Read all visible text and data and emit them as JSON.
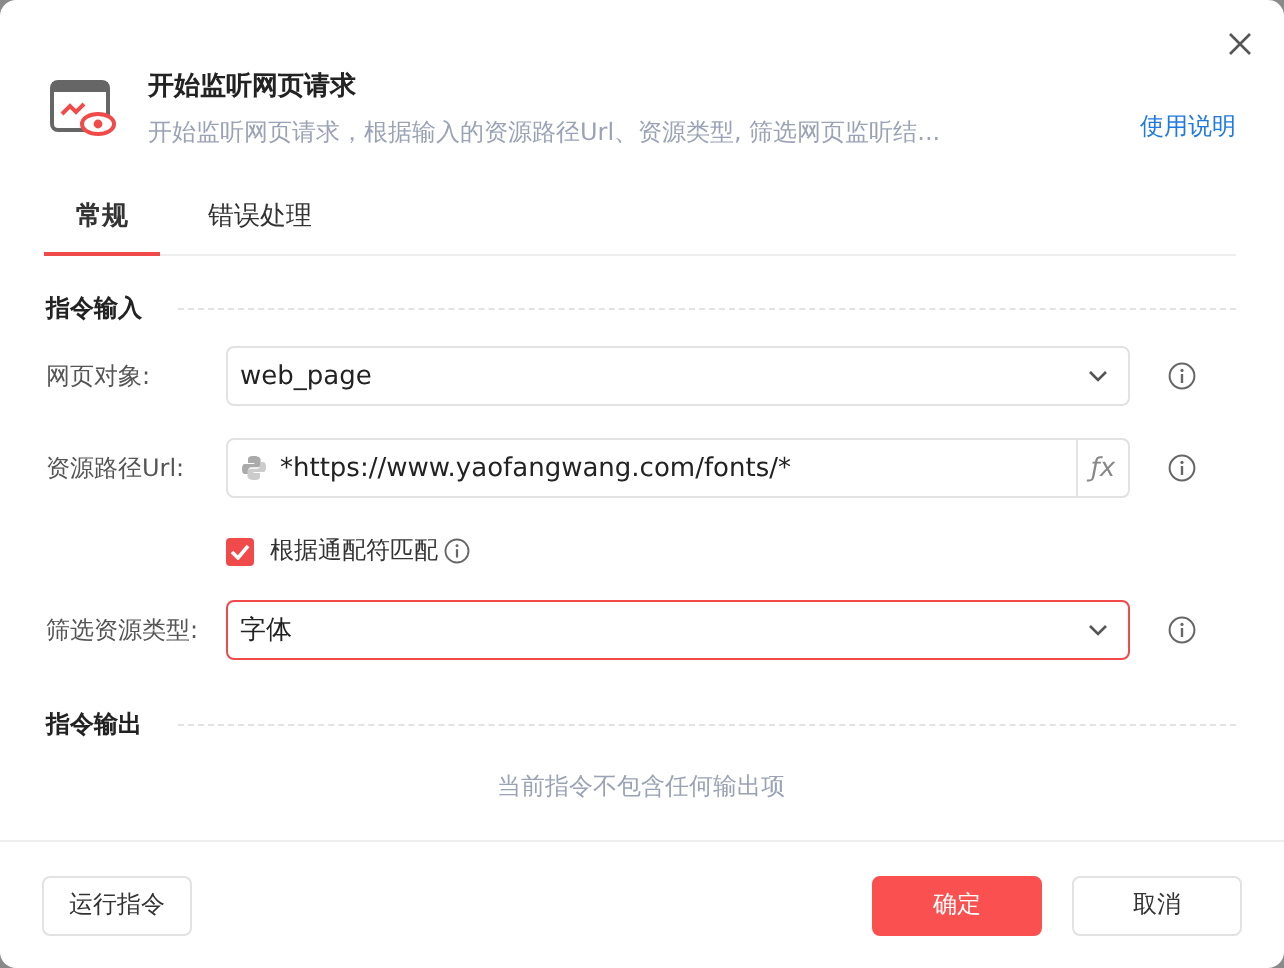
{
  "header": {
    "title": "开始监听网页请求",
    "description": "开始监听网页请求，根据输入的资源路径Url、资源类型, 筛选网页监听结...",
    "help_link": "使用说明"
  },
  "tabs": [
    {
      "label": "常规",
      "selected": true
    },
    {
      "label": "错误处理",
      "selected": false
    }
  ],
  "input_section": {
    "title": "指令输入",
    "fields": [
      {
        "kind": "select",
        "label": "网页对象:",
        "value": "web_page",
        "focused": false
      },
      {
        "kind": "expression",
        "label": "资源路径Url:",
        "value": "*https://www.yaofangwang.com/fonts/*",
        "fx": "ƒx"
      },
      {
        "kind": "checkbox",
        "label": "根据通配符匹配",
        "checked": true
      },
      {
        "kind": "select",
        "label": "筛选资源类型:",
        "value": "字体",
        "focused": true
      }
    ]
  },
  "output_section": {
    "title": "指令输出",
    "empty_text": "当前指令不包含任何输出项"
  },
  "footer": {
    "run_button": "运行指令",
    "ok_button": "确定",
    "cancel_button": "取消"
  }
}
